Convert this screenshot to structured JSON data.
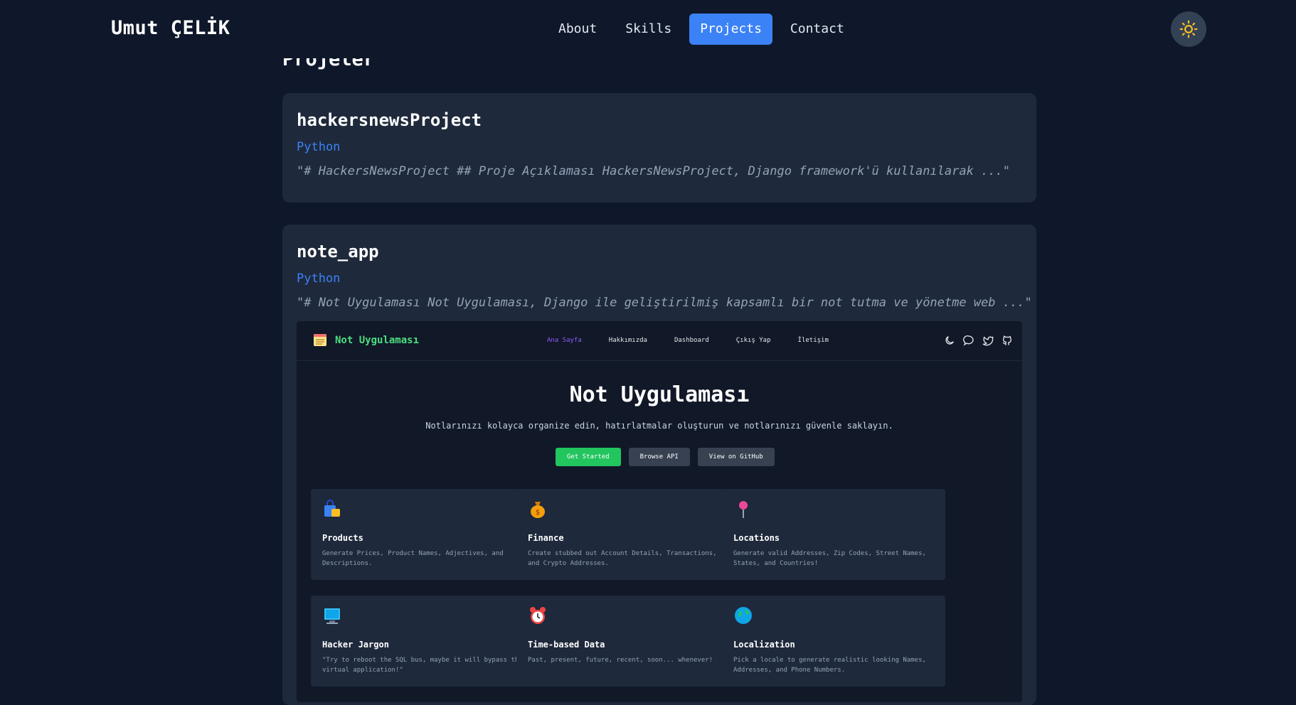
{
  "header": {
    "brand": "Umut ÇELİK",
    "nav": [
      "About",
      "Skills",
      "Projects",
      "Contact"
    ],
    "active_nav": "Projects",
    "theme_icon": "sun-icon"
  },
  "section": {
    "title": "Projeler"
  },
  "projects": [
    {
      "title": "hackersnewsProject",
      "language": "Python",
      "description": "\"# HackersNewsProject ## Proje Açıklaması HackersNewsProject, Django framework'ü kullanılarak ...\""
    },
    {
      "title": "note_app",
      "language": "Python",
      "description": "\"# Not Uygulaması Not Uygulaması, Django ile geliştirilmiş kapsamlı bir not tutma ve yönetme web ...\""
    }
  ],
  "preview": {
    "logo_text": "Not Uygulaması",
    "nav": [
      "Ana Sayfa",
      "Hakkımızda",
      "Dashboard",
      "Çıkış Yap",
      "İletişim"
    ],
    "hero_title": "Not Uygulaması",
    "hero_subtitle": "Notlarınızı kolayca organize edin, hatırlatmalar oluşturun ve notlarınızı güvenle saklayın.",
    "buttons": [
      "Get Started",
      "Browse API",
      "View on GitHub"
    ],
    "features": [
      {
        "icon": "shopping-bags-icon",
        "title": "Products",
        "desc": "Generate Prices, Product Names, Adjectives, and Descriptions."
      },
      {
        "icon": "money-bag-icon",
        "title": "Finance",
        "desc": "Create stubbed out Account Details, Transactions, and Crypto Addresses."
      },
      {
        "icon": "pushpin-icon",
        "title": "Locations",
        "desc": "Generate valid Addresses, Zip Codes, Street Names, States, and Countries!"
      },
      {
        "icon": "computer-icon",
        "title": "Hacker Jargon",
        "desc": "\"Try to reboot the SQL bus, maybe it will bypass the virtual application!\""
      },
      {
        "icon": "alarm-clock-icon",
        "title": "Time-based Data",
        "desc": "Past, present, future, recent, soon... whenever!"
      },
      {
        "icon": "globe-icon",
        "title": "Localization",
        "desc": "Pick a locale to generate realistic looking Names, Addresses, and Phone Numbers."
      }
    ]
  },
  "colors": {
    "background": "#0f172a",
    "card": "#1e293b",
    "accent": "#3b82f6",
    "green": "#22c55e"
  }
}
